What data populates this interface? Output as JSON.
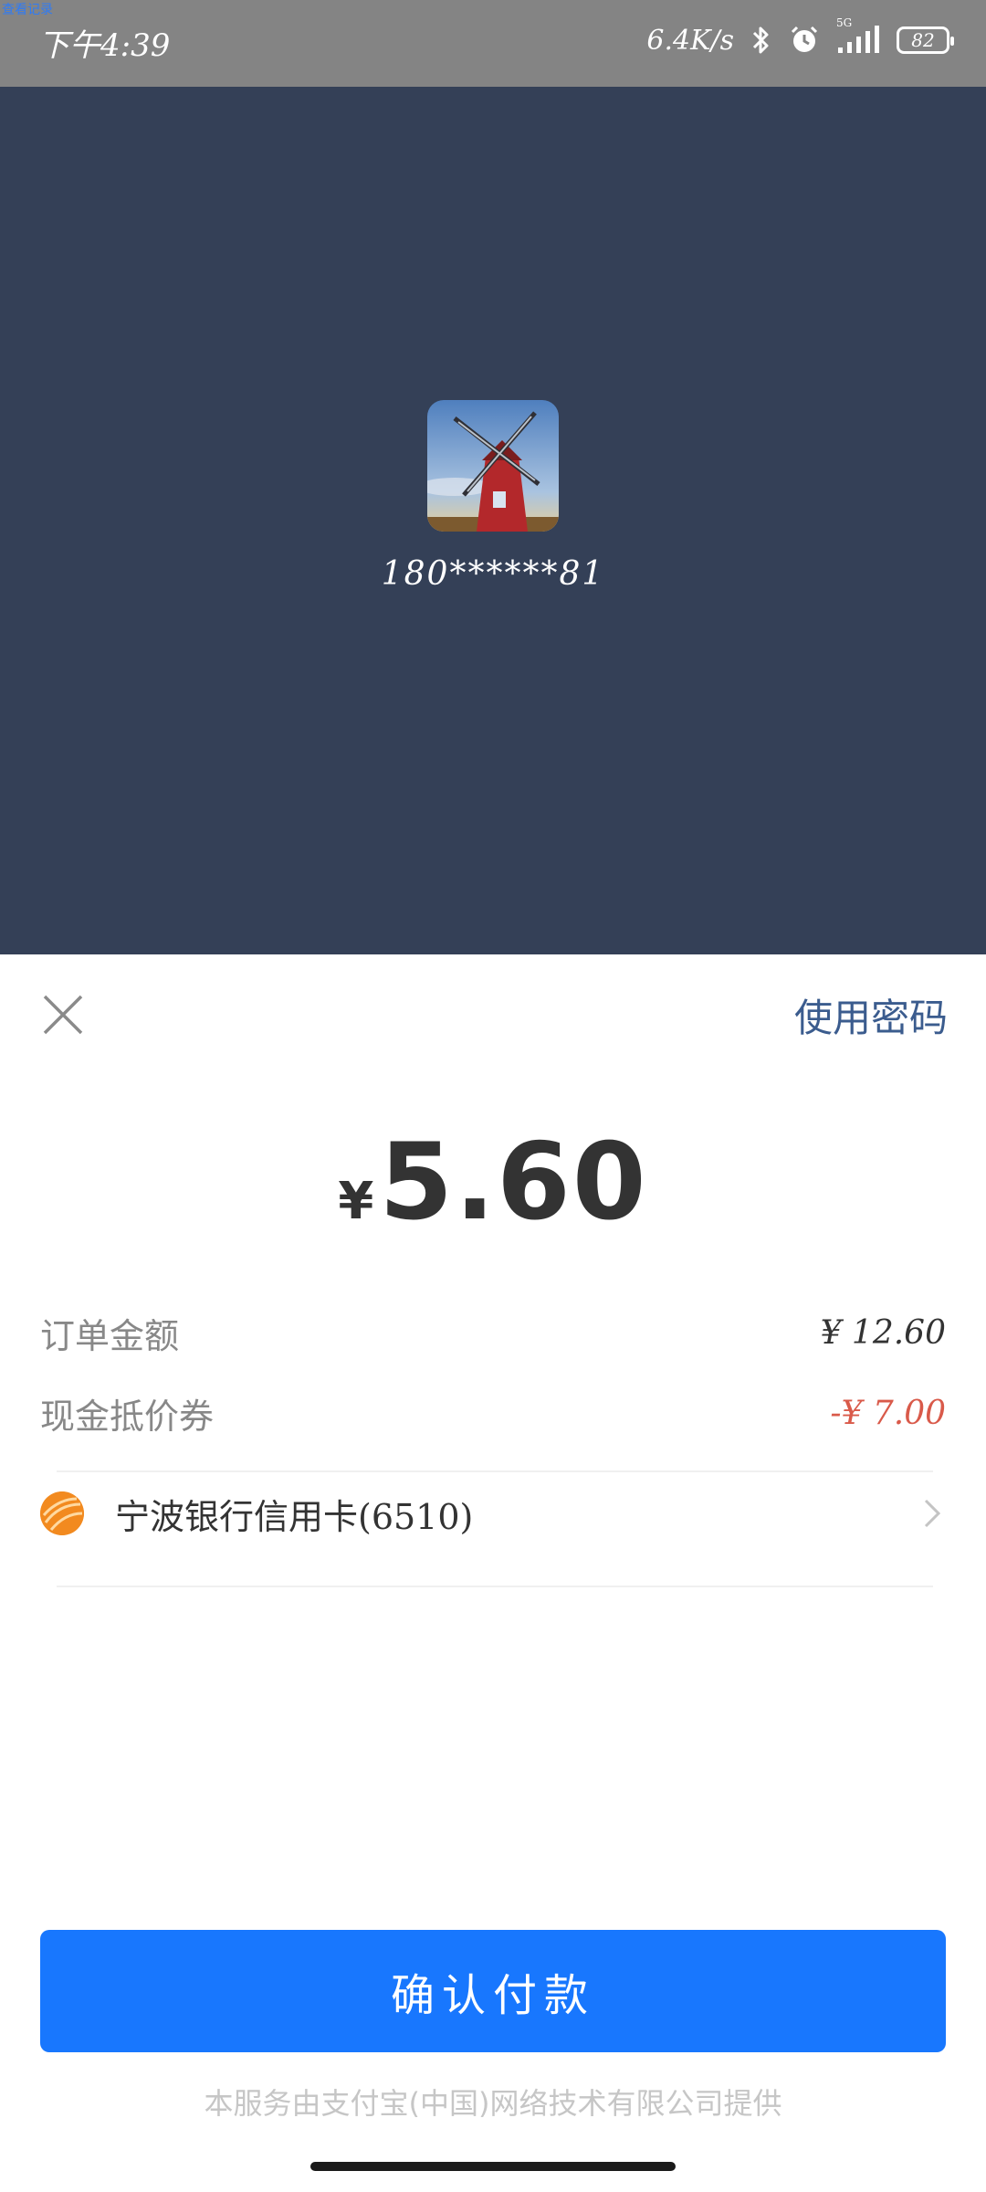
{
  "status_bar": {
    "time": "下午4:39",
    "net_speed": "6.4K/s",
    "network": "5G",
    "battery": "82",
    "top_link": "查看记录"
  },
  "payee": {
    "account": "180******81"
  },
  "sheet": {
    "use_password": "使用密码",
    "amount_symbol": "¥",
    "amount": "5.60",
    "rows": [
      {
        "label": "订单金额",
        "value": "¥  12.60"
      },
      {
        "label": "现金抵价券",
        "value": "-¥  7.00"
      }
    ],
    "payment_method": "宁波银行信用卡(6510)",
    "confirm_label": "确认付款",
    "footer": "本服务由支付宝(中国)网络技术有限公司提供"
  },
  "colors": {
    "header_bg": "#344057",
    "primary": "#1877fe",
    "discount": "#d95a4a"
  },
  "icons": [
    "bluetooth-icon",
    "alarm-icon",
    "signal-icon",
    "battery-icon",
    "close-icon",
    "bank-logo-icon",
    "chevron-right-icon"
  ]
}
